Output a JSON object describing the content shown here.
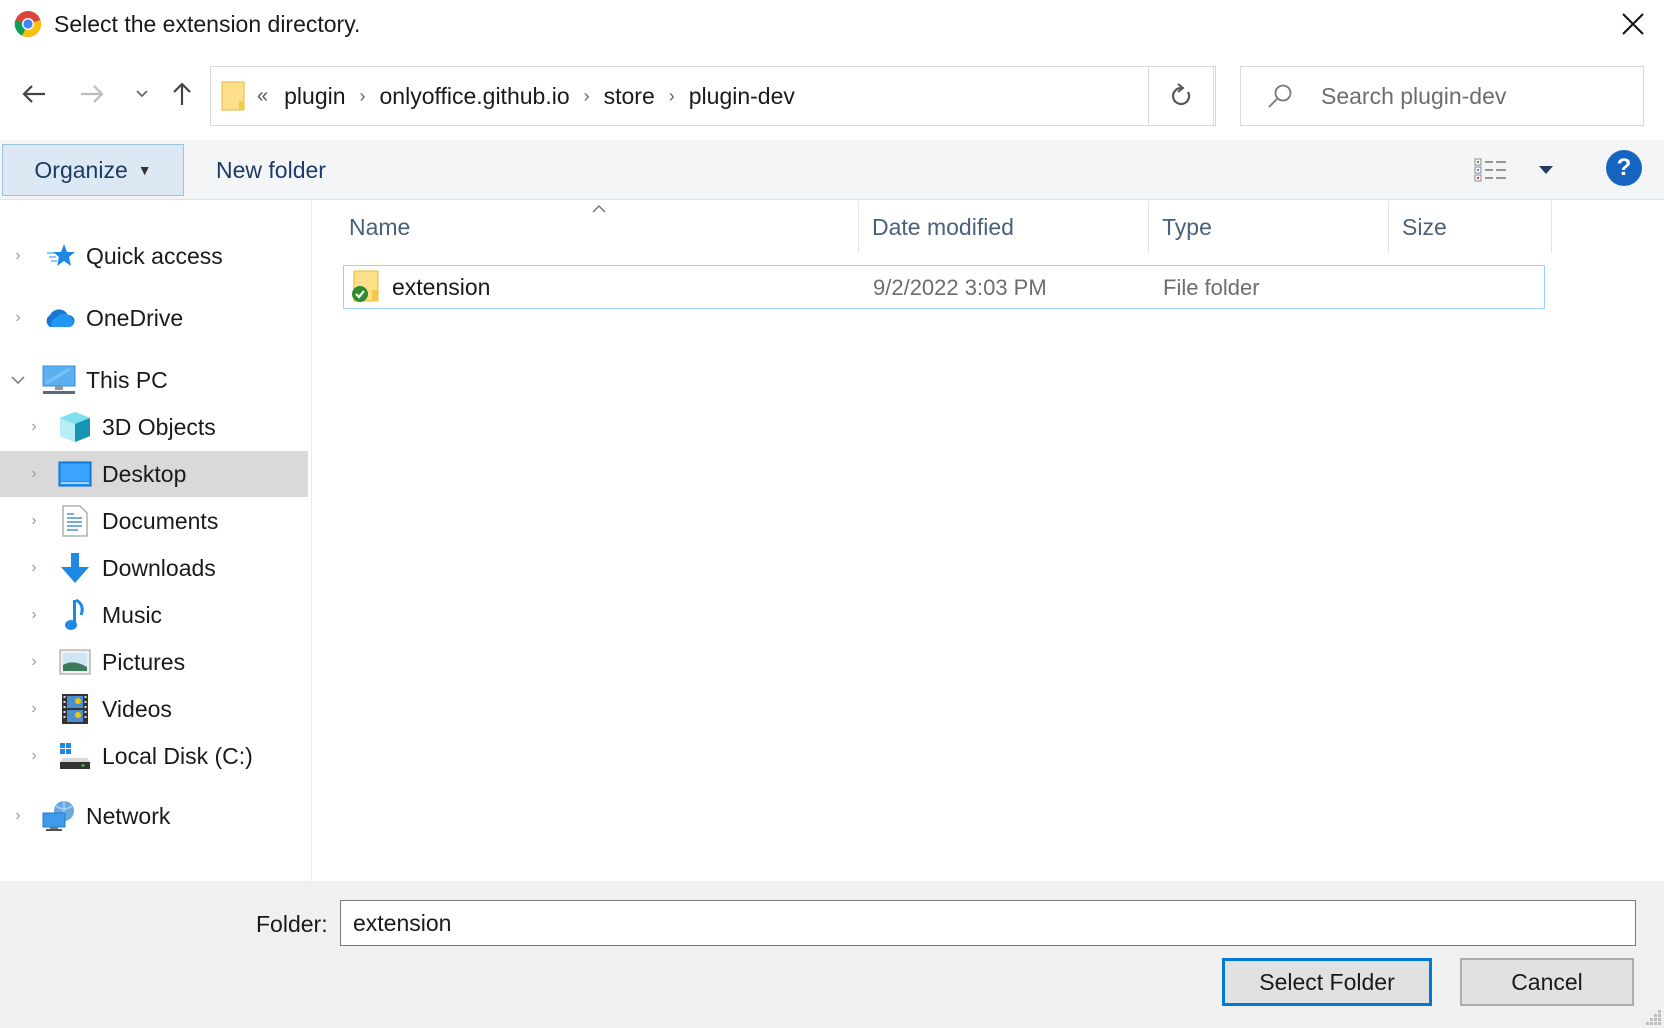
{
  "window": {
    "title": "Select the extension directory.",
    "app_icon": "chrome-icon",
    "close_icon": "close-icon"
  },
  "navigation": {
    "back_icon": "arrow-left-icon",
    "forward_icon": "arrow-right-icon",
    "recent_icon": "chevron-down-icon",
    "up_icon": "arrow-up-icon",
    "address": {
      "overflow": "«",
      "crumbs": [
        "plugin",
        "onlyoffice.github.io",
        "store",
        "plugin-dev"
      ],
      "separator": "›"
    },
    "refresh_icon": "refresh-icon",
    "search": {
      "placeholder": "Search plugin-dev",
      "value": ""
    }
  },
  "toolbar": {
    "organize_label": "Organize",
    "new_folder_label": "New folder",
    "help_label": "?"
  },
  "sidebar": {
    "items": [
      {
        "label": "Quick access",
        "icon": "quick-access-star-icon",
        "expanded": false,
        "level": 0
      },
      {
        "label": "OneDrive",
        "icon": "onedrive-cloud-icon",
        "expanded": false,
        "level": 0
      },
      {
        "label": "This PC",
        "icon": "this-pc-monitor-icon",
        "expanded": true,
        "level": 0
      },
      {
        "label": "3D Objects",
        "icon": "3d-objects-icon",
        "expanded": false,
        "level": 1
      },
      {
        "label": "Desktop",
        "icon": "desktop-icon",
        "expanded": false,
        "level": 1,
        "selected": true
      },
      {
        "label": "Documents",
        "icon": "documents-icon",
        "expanded": false,
        "level": 1
      },
      {
        "label": "Downloads",
        "icon": "downloads-icon",
        "expanded": false,
        "level": 1
      },
      {
        "label": "Music",
        "icon": "music-icon",
        "expanded": false,
        "level": 1
      },
      {
        "label": "Pictures",
        "icon": "pictures-icon",
        "expanded": false,
        "level": 1
      },
      {
        "label": "Videos",
        "icon": "videos-icon",
        "expanded": false,
        "level": 1
      },
      {
        "label": "Local Disk (C:)",
        "icon": "local-disk-icon",
        "expanded": false,
        "level": 1
      },
      {
        "label": "Network",
        "icon": "network-icon",
        "expanded": false,
        "level": 0
      }
    ]
  },
  "filelist": {
    "columns": [
      "Name",
      "Date modified",
      "Type",
      "Size"
    ],
    "sort_column": "Name",
    "rows": [
      {
        "name": "extension",
        "date_modified": "9/2/2022 3:03 PM",
        "type": "File folder",
        "size": "",
        "icon": "folder-synced-icon"
      }
    ]
  },
  "footer": {
    "folder_label": "Folder:",
    "folder_value": "extension",
    "select_label": "Select Folder",
    "cancel_label": "Cancel"
  },
  "colors": {
    "accent": "#0078d7",
    "selection_border": "#99d1ff",
    "organize_bg": "#dce9f5",
    "help_blue": "#1565c0"
  }
}
